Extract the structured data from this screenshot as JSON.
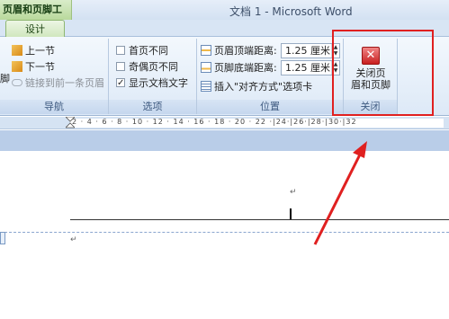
{
  "window": {
    "context_tab": "页眉和页脚工具",
    "title": "文档 1 - Microsoft Word"
  },
  "tabs": {
    "design": "设计"
  },
  "nav_group": {
    "prev_section": "上一节",
    "next_section": "下一节",
    "link_to_previous": "链接到前一条页眉",
    "left_clip": "脚",
    "label": "导航"
  },
  "options_group": {
    "different_first_page": "首页不同",
    "different_odd_even": "奇偶页不同",
    "show_document_text": "显示文档文字",
    "show_document_text_checked": true,
    "label": "选项"
  },
  "position_group": {
    "header_from_top_label": "页眉顶端距离:",
    "header_from_top_value": "1.25 厘米",
    "footer_from_bottom_label": "页脚底端距离:",
    "footer_from_bottom_value": "1.25 厘米",
    "insert_alignment_tab": "插入\"对齐方式\"选项卡",
    "label": "位置"
  },
  "close_group": {
    "close_button_line1": "关闭页",
    "close_button_line2": "眉和页脚",
    "label": "关闭"
  },
  "ruler": {
    "marks": "2 · 4 · 6 · 8 · 10 · 12 · 14 · 16 · 18 · 20 · 22 ·|24·|26·|28·|30·|32"
  },
  "colors": {
    "highlight": "#e02020",
    "ribbon_bg": "#dde9f7",
    "context_tab": "#b9d99c"
  }
}
